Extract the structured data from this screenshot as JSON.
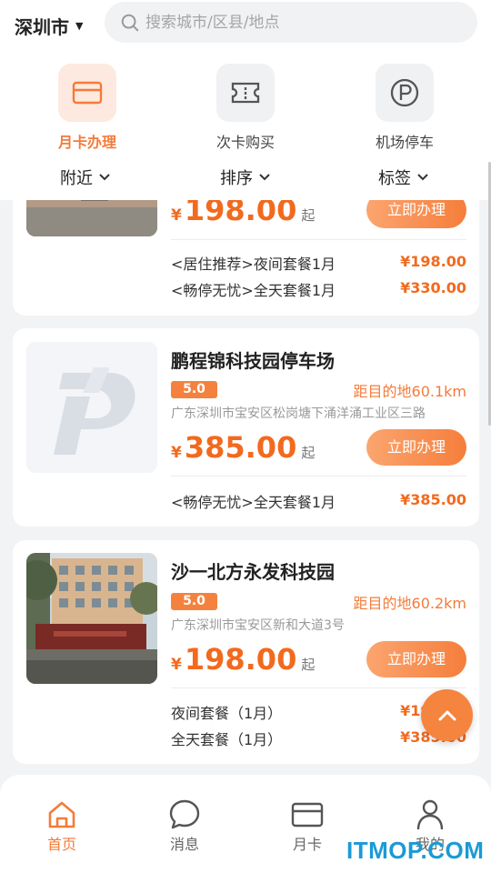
{
  "header": {
    "city": "深圳市",
    "search_placeholder": "搜索城市/区县/地点"
  },
  "categories": [
    {
      "label": "月卡办理",
      "icon": "card-icon",
      "active": true
    },
    {
      "label": "次卡购买",
      "icon": "ticket-icon",
      "active": false
    },
    {
      "label": "机场停车",
      "icon": "parking-icon",
      "active": false
    }
  ],
  "filters": [
    "附近",
    "排序",
    "标签"
  ],
  "cards": [
    {
      "price": "198.00",
      "price_symbol": "¥",
      "price_suffix": "起",
      "button": "立即办理",
      "packages": [
        {
          "name": "<居住推荐>夜间套餐1月",
          "price": "¥198.00"
        },
        {
          "name": "<畅停无忧>全天套餐1月",
          "price": "¥330.00"
        }
      ]
    },
    {
      "title": "鹏程锦科技园停车场",
      "rating": "5.0",
      "distance": "距目的地60.1km",
      "address": "广东深圳市宝安区松岗塘下涌洋涌工业区三路",
      "price": "385.00",
      "price_symbol": "¥",
      "price_suffix": "起",
      "button": "立即办理",
      "packages": [
        {
          "name": "<畅停无忧>全天套餐1月",
          "price": "¥385.00"
        }
      ]
    },
    {
      "title": "沙一北方永发科技园",
      "rating": "5.0",
      "distance": "距目的地60.2km",
      "address": "广东深圳市宝安区新和大道3号",
      "price": "198.00",
      "price_symbol": "¥",
      "price_suffix": "起",
      "button": "立即办理",
      "packages": [
        {
          "name": "夜间套餐（1月）",
          "price": "¥198.00"
        },
        {
          "name": "全天套餐（1月）",
          "price": "¥385.00"
        }
      ]
    }
  ],
  "bottom_nav": [
    {
      "label": "首页",
      "icon": "home-icon",
      "active": true
    },
    {
      "label": "消息",
      "icon": "message-icon",
      "active": false
    },
    {
      "label": "月卡",
      "icon": "card-icon",
      "active": false
    },
    {
      "label": "我的",
      "icon": "user-icon",
      "active": false
    }
  ],
  "watermark": "ITMOP.COM",
  "colors": {
    "accent": "#f47b3a",
    "price": "#f26a1e",
    "background": "#f2f3f5"
  }
}
